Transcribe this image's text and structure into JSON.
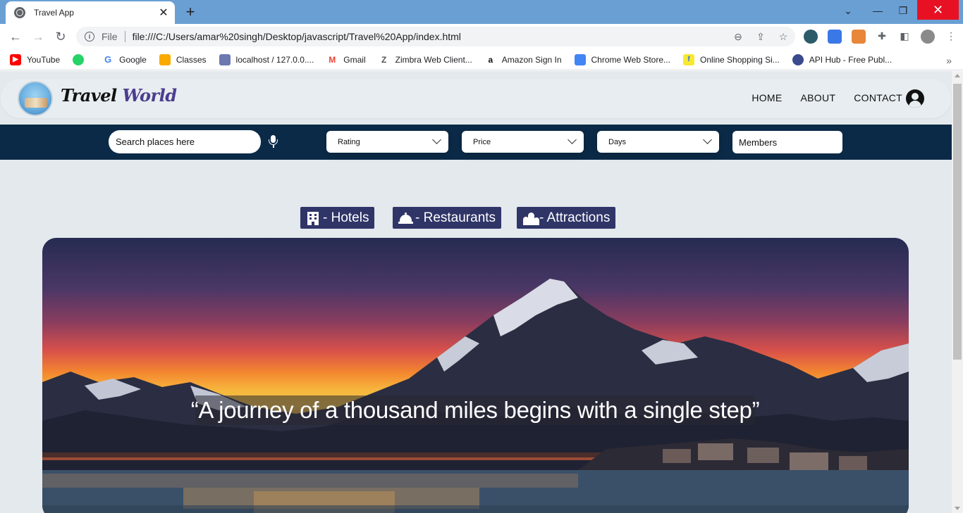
{
  "browser": {
    "tab_title": "Travel App",
    "url_scheme_label": "File",
    "url": "file:///C:/Users/amar%20singh/Desktop/javascript/Travel%20App/index.html",
    "bookmarks": [
      {
        "label": "YouTube",
        "icon": "youtube-icon",
        "color": "#ff0000"
      },
      {
        "label": "",
        "icon": "whatsapp-icon",
        "color": "#25d366"
      },
      {
        "label": "Google",
        "icon": "google-icon",
        "color": "#4285f4"
      },
      {
        "label": "Classes",
        "icon": "classroom-icon",
        "color": "#f9ab00"
      },
      {
        "label": "localhost / 127.0.0....",
        "icon": "phpmyadmin-icon",
        "color": "#6c78af"
      },
      {
        "label": "Gmail",
        "icon": "gmail-icon",
        "color": "#ea4335"
      },
      {
        "label": "Zimbra Web Client...",
        "icon": "zimbra-icon",
        "color": "#555555"
      },
      {
        "label": "Amazon Sign In",
        "icon": "amazon-icon",
        "color": "#111111"
      },
      {
        "label": "Chrome Web Store...",
        "icon": "chrome-web-store-icon",
        "color": "#4285f4"
      },
      {
        "label": "Online Shopping Si...",
        "icon": "flipkart-icon",
        "color": "#f8e831"
      },
      {
        "label": "API Hub - Free Publ...",
        "icon": "api-hub-icon",
        "color": "#3b4a8c"
      }
    ]
  },
  "site": {
    "brand_part1": "Travel",
    "brand_part2": "World",
    "nav": [
      "HOME",
      "ABOUT",
      "CONTACT"
    ],
    "search_placeholder": "Search places here",
    "filters": {
      "rating": "Rating",
      "price": "Price",
      "days": "Days",
      "members": "Members"
    },
    "categories": [
      {
        "label": "- Hotels",
        "icon": "hotel-icon"
      },
      {
        "label": "- Restaurants",
        "icon": "concierge-bell-icon"
      },
      {
        "label": "- Attractions",
        "icon": "landmark-icon"
      }
    ],
    "hero_quote": "“A journey of a thousand miles begins with a single step”",
    "colors": {
      "header_bg": "#e7edf0",
      "filter_bar": "#0b2a47",
      "category_button": "#2f3567",
      "brand_accent": "#4b3d8f"
    }
  }
}
